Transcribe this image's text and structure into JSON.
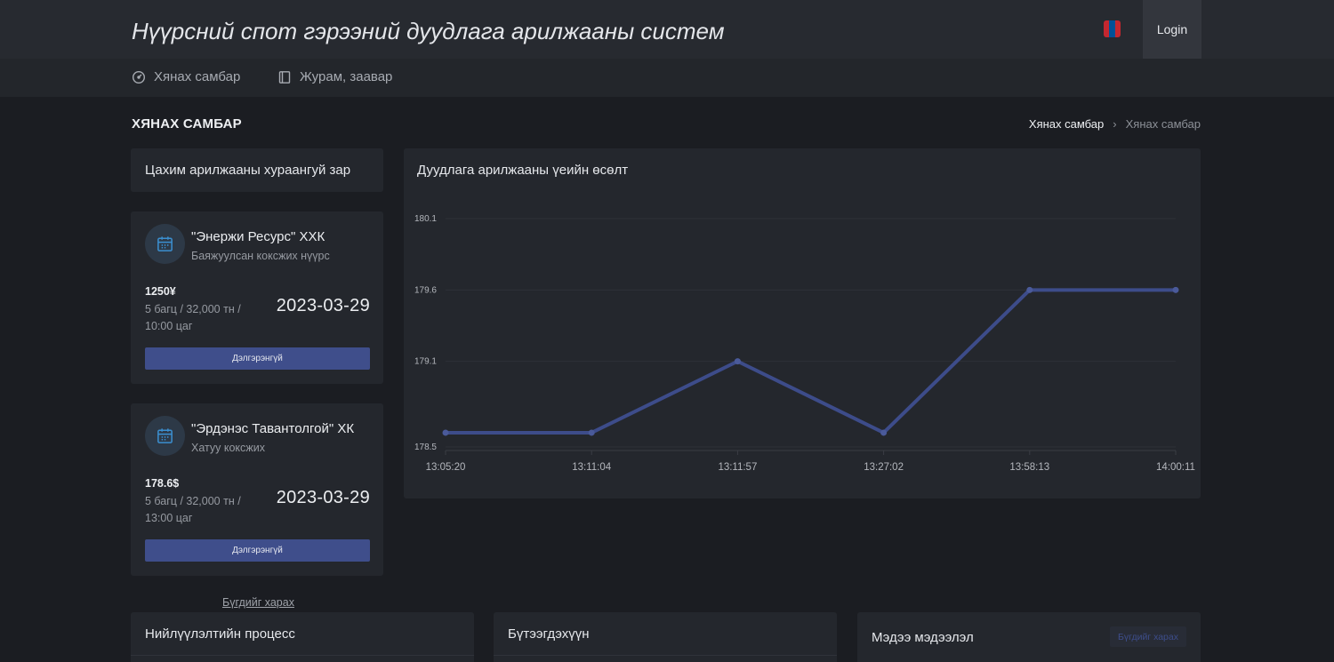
{
  "header": {
    "title": "Нүүрсний спот гэрээний дуудлага арилжааны систем",
    "flag_icon": "mongolian-flag-icon",
    "login_label": "Login"
  },
  "nav": {
    "items": [
      {
        "label": "Хянах самбар",
        "icon": "dashboard-gauge-icon"
      },
      {
        "label": "Журам, заавар",
        "icon": "book-icon"
      }
    ]
  },
  "page": {
    "title": "ХЯНАХ САМБАР",
    "breadcrumb": [
      "Хянах самбар",
      "Хянах самбар"
    ]
  },
  "announcements": {
    "title": "Цахим арилжааны хураангуй зар",
    "items": [
      {
        "company": "\"Энержи Ресурс\" ХХК",
        "product": "Баяжуулсан коксжих нүүрс",
        "price": "1250¥",
        "details": "5 багц / 32,000 тн / 10:00 цаг",
        "date": "2023-03-29",
        "button": "Дэлгэрэнгүй",
        "icon": "calendar-icon"
      },
      {
        "company": "\"Эрдэнэс Тавантолгой\" ХК",
        "product": "Хатуу коксжих",
        "price": "178.6$",
        "details": "5 багц / 32,000 тн / 13:00 цаг",
        "date": "2023-03-29",
        "button": "Дэлгэрэнгүй",
        "icon": "calendar-icon"
      }
    ],
    "see_all": "Бүгдийг харах"
  },
  "chart_card": {
    "title": "Дуудлага арилжааны үеийн өсөлт"
  },
  "chart_data": {
    "type": "line",
    "title": "Дуудлага арилжааны үеийн өсөлт",
    "x": [
      "13:05:20",
      "13:11:04",
      "13:11:57",
      "13:27:02",
      "13:58:13",
      "14:00:11"
    ],
    "series": [
      {
        "values": [
          178.6,
          178.6,
          179.1,
          178.6,
          179.6,
          179.6
        ]
      }
    ],
    "yticks": [
      "178.5",
      "179.1",
      "179.6",
      "180.1"
    ],
    "ylim": [
      178.5,
      180.1
    ],
    "grid": true,
    "color": "#3d4c8a"
  },
  "bottom": {
    "process_title": "Нийлүүлэлтийн процесс",
    "products_title": "Бүтээгдэхүүн",
    "news_title": "Мэдээ мэдээлэл",
    "news_see_all": "Бүгдийг харах"
  },
  "colors": {
    "background": "#1b1d22",
    "card": "#24272d",
    "accent": "#3f4e8b",
    "icon_blue": "#3b8fd0"
  }
}
